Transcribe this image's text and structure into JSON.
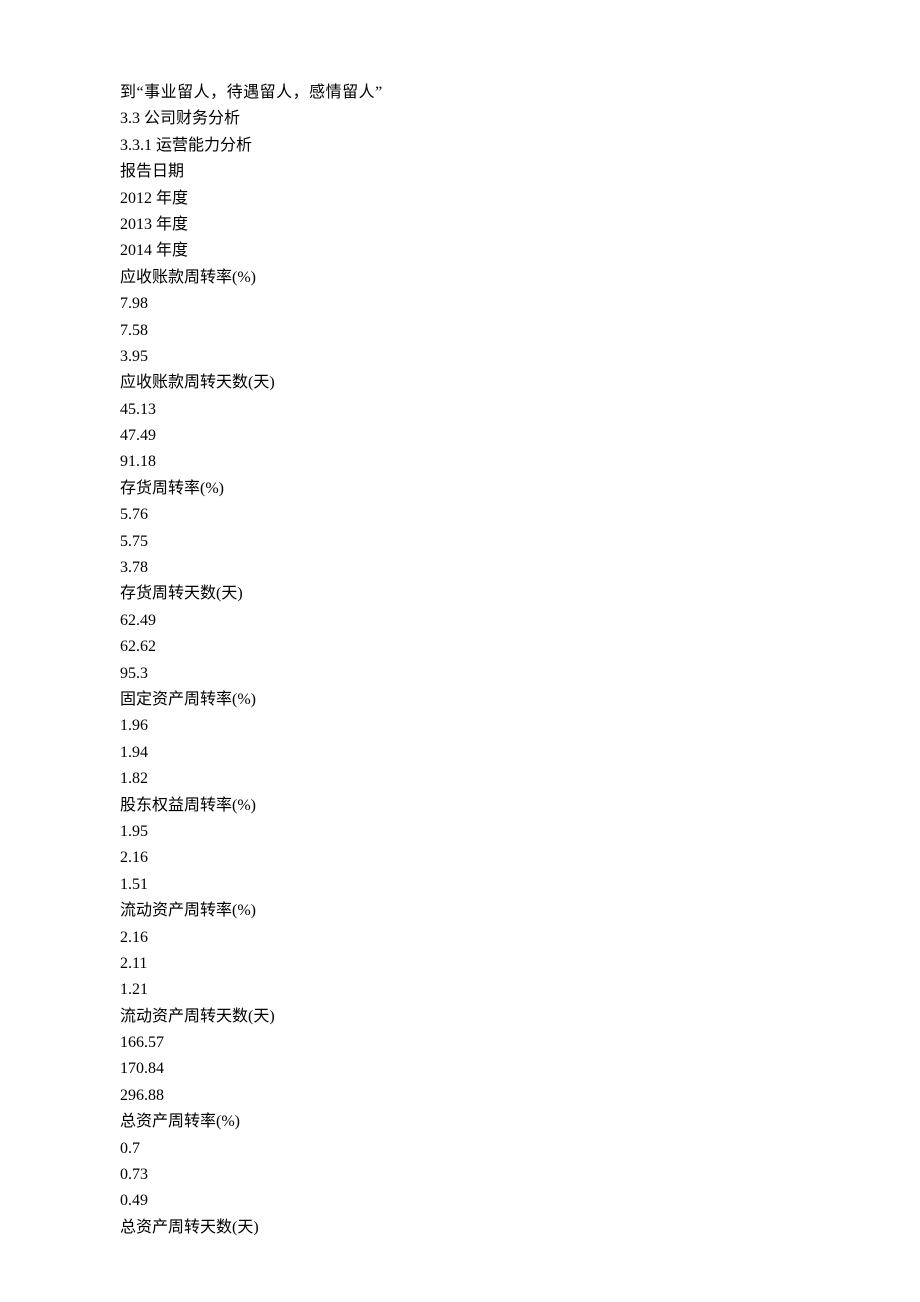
{
  "intro_line": "到“事业留人，待遇留人，感情留人”",
  "section_3_3": "3.3 公司财务分析",
  "section_3_3_1": "3.3.1  运营能力分析",
  "report_date_label": "报告日期",
  "years": [
    "2012 年度",
    "2013 年度",
    "2014 年度"
  ],
  "metrics": [
    {
      "label": "应收账款周转率(%)",
      "values": [
        "7.98",
        "7.58",
        "3.95"
      ]
    },
    {
      "label": "应收账款周转天数(天)",
      "values": [
        "45.13",
        "47.49",
        "91.18"
      ]
    },
    {
      "label": "存货周转率(%)",
      "values": [
        "5.76",
        "5.75",
        "3.78"
      ]
    },
    {
      "label": "存货周转天数(天)",
      "values": [
        "62.49",
        "62.62",
        "95.3"
      ]
    },
    {
      "label": "固定资产周转率(%)",
      "values": [
        "1.96",
        "1.94",
        "1.82"
      ]
    },
    {
      "label": "股东权益周转率(%)",
      "values": [
        "1.95",
        "2.16",
        "1.51"
      ]
    },
    {
      "label": "流动资产周转率(%)",
      "values": [
        "2.16",
        "2.11",
        "1.21"
      ]
    },
    {
      "label": "流动资产周转天数(天)",
      "values": [
        "166.57",
        "170.84",
        "296.88"
      ]
    },
    {
      "label": "总资产周转率(%)",
      "values": [
        "0.7",
        "0.73",
        "0.49"
      ]
    },
    {
      "label": "总资产周转天数(天)",
      "values": []
    }
  ]
}
